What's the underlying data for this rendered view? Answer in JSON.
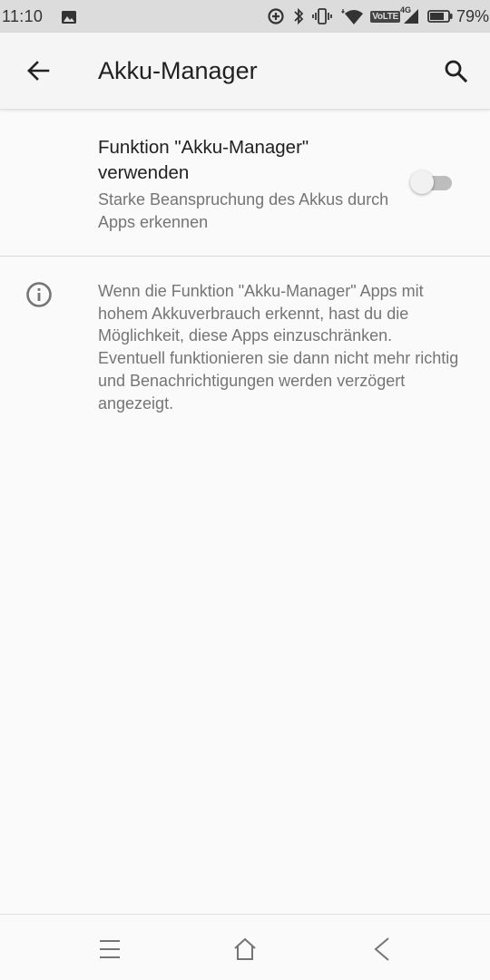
{
  "status_bar": {
    "time": "11:10",
    "network_label": "VoLTE",
    "network_gen": "4G",
    "battery_percent": "79%",
    "battery_level": 0.79,
    "icons": [
      "image-icon",
      "data-saver-icon",
      "bluetooth-icon",
      "vibrate-icon",
      "wifi-icon",
      "signal-icon",
      "battery-icon"
    ]
  },
  "app_bar": {
    "title": "Akku-Manager",
    "back_icon": "arrow-back-icon",
    "search_icon": "search-icon"
  },
  "setting": {
    "title": "Funktion \"Akku-Manager\" verwenden",
    "summary": "Starke Beanspruchung des Akkus durch Apps erkennen",
    "toggle_on": false
  },
  "info": {
    "icon": "info-icon",
    "text": "Wenn die Funktion \"Akku-Manager\" Apps mit hohem Akkuverbrauch erkennt, hast du die Möglichkeit, diese Apps einzuschränken. Eventuell funktionieren sie dann nicht mehr richtig und Benachrichtigungen werden verzögert angezeigt."
  },
  "nav_bar": {
    "icons": [
      "menu-icon",
      "home-icon",
      "back-icon"
    ]
  },
  "colors": {
    "status_bar_bg": "#dcdcdc",
    "app_bar_bg": "#f5f5f5",
    "page_bg": "#fafafa",
    "primary_text": "#212121",
    "secondary_text": "#757575",
    "toggle_track": "#bdbdbd",
    "toggle_thumb": "#f1f1f1"
  }
}
